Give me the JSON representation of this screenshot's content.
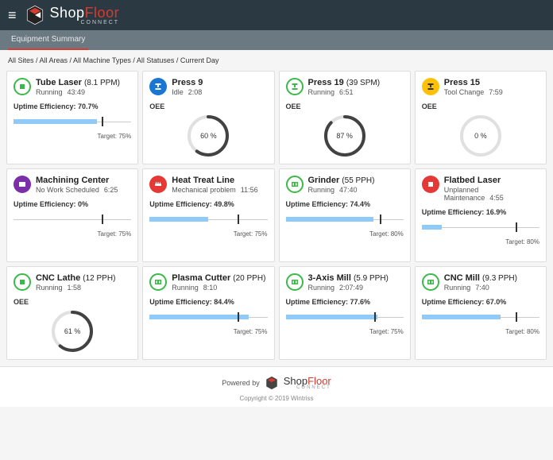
{
  "header": {
    "brand_shop": "Shop",
    "brand_floor": "Floor",
    "brand_sub": "CONNECT"
  },
  "tab": {
    "label": "Equipment Summary"
  },
  "breadcrumb": "All Sites / All Areas / All Machine Types / All Statuses / Current Day",
  "cards": [
    {
      "name": "Tube Laser",
      "rate": "(8.1 PPM)",
      "status": "Running",
      "time": "43:49",
      "metric": "Uptime Efficiency:",
      "value": "70.7%",
      "bar_pct": 70.7,
      "target_pct": 75,
      "target_label": "Target: 75%",
      "icon_color": "green",
      "icon": "square"
    },
    {
      "name": "Press 9",
      "rate": "",
      "status": "Idle",
      "time": "2:08",
      "metric": "OEE",
      "gauge": 60,
      "icon_color": "blue",
      "icon": "press"
    },
    {
      "name": "Press 19",
      "rate": "(39 SPM)",
      "status": "Running",
      "time": "6:51",
      "metric": "OEE",
      "gauge": 87,
      "icon_color": "green",
      "icon": "press"
    },
    {
      "name": "Press 15",
      "rate": "",
      "status": "Tool Change",
      "time": "7:59",
      "metric": "OEE",
      "gauge": 0,
      "icon_color": "yellow",
      "icon": "press"
    },
    {
      "name": "Machining Center",
      "rate": "",
      "status": "No Work Scheduled",
      "time": "6:25",
      "metric": "Uptime Efficiency:",
      "value": "0%",
      "bar_pct": 0,
      "target_pct": 75,
      "target_label": "Target: 75%",
      "icon_color": "purple",
      "icon": "mill"
    },
    {
      "name": "Heat Treat Line",
      "rate": "",
      "status": "Mechanical problem",
      "time": "11:56",
      "metric": "Uptime Efficiency:",
      "value": "49.8%",
      "bar_pct": 49.8,
      "target_pct": 75,
      "target_label": "Target: 75%",
      "icon_color": "red",
      "icon": "heat"
    },
    {
      "name": "Grinder",
      "rate": "(55 PPH)",
      "status": "Running",
      "time": "47:40",
      "metric": "Uptime Efficiency:",
      "value": "74.4%",
      "bar_pct": 74.4,
      "target_pct": 80,
      "target_label": "Target: 80%",
      "icon_color": "green",
      "icon": "mill"
    },
    {
      "name": "Flatbed Laser",
      "rate": "",
      "status": "Unplanned Maintenance",
      "time": "4:55",
      "metric": "Uptime Efficiency:",
      "value": "16.9%",
      "bar_pct": 16.9,
      "target_pct": 80,
      "target_label": "Target: 80%",
      "icon_color": "red",
      "icon": "square"
    },
    {
      "name": "CNC Lathe",
      "rate": "(12 PPH)",
      "status": "Running",
      "time": "1:58",
      "metric": "OEE",
      "gauge": 61,
      "icon_color": "green",
      "icon": "square"
    },
    {
      "name": "Plasma Cutter",
      "rate": "(20 PPH)",
      "status": "Running",
      "time": "8:10",
      "metric": "Uptime Efficiency:",
      "value": "84.4%",
      "bar_pct": 84.4,
      "target_pct": 75,
      "target_label": "Target: 75%",
      "icon_color": "green",
      "icon": "mill"
    },
    {
      "name": "3-Axis Mill",
      "rate": "(5.9 PPH)",
      "status": "Running",
      "time": "2:07:49",
      "metric": "Uptime Efficiency:",
      "value": "77.6%",
      "bar_pct": 77.6,
      "target_pct": 75,
      "target_label": "Target: 75%",
      "icon_color": "green",
      "icon": "mill"
    },
    {
      "name": "CNC Mill",
      "rate": "(9.3 PPH)",
      "status": "Running",
      "time": "7:40",
      "metric": "Uptime Efficiency:",
      "value": "67.0%",
      "bar_pct": 67.0,
      "target_pct": 80,
      "target_label": "Target: 80%",
      "icon_color": "green",
      "icon": "mill"
    }
  ],
  "footer": {
    "powered": "Powered by",
    "brand_shop": "Shop",
    "brand_floor": "Floor",
    "brand_sub": "CONNECT",
    "copyright": "Copyright © 2019 Wintriss"
  }
}
